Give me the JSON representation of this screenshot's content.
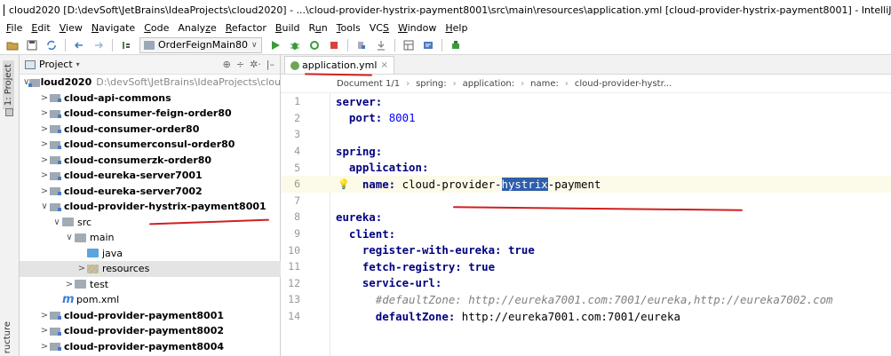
{
  "window": {
    "title": "cloud2020 [D:\\devSoft\\JetBrains\\IdeaProjects\\cloud2020] - ...\\cloud-provider-hystrix-payment8001\\src\\main\\resources\\application.yml [cloud-provider-hystrix-payment8001] - IntelliJ IDEA"
  },
  "menu": [
    {
      "mn": "F",
      "rest": "ile"
    },
    {
      "mn": "E",
      "rest": "dit"
    },
    {
      "mn": "V",
      "rest": "iew"
    },
    {
      "mn": "N",
      "rest": "avigate"
    },
    {
      "mn": "C",
      "rest": "ode"
    },
    {
      "mn": "",
      "rest": "Analy",
      "mn2": "z",
      "rest2": "e"
    },
    {
      "mn": "R",
      "rest": "efactor"
    },
    {
      "mn": "B",
      "rest": "uild"
    },
    {
      "mn": "",
      "rest": "R",
      "mn2": "u",
      "rest2": "n"
    },
    {
      "mn": "T",
      "rest": "ools"
    },
    {
      "mn": "",
      "rest": "VC",
      "mn2": "S",
      "rest2": ""
    },
    {
      "mn": "W",
      "rest": "indow"
    },
    {
      "mn": "H",
      "rest": "elp"
    }
  ],
  "toolbar": {
    "run_config": "OrderFeignMain80"
  },
  "side": {
    "project_tab": "1: Project",
    "structure_tab": "ructure"
  },
  "project_panel": {
    "title": "Project",
    "tree": [
      {
        "label": "cloud2020",
        "path": "D:\\devSoft\\JetBrains\\IdeaProjects\\clou",
        "arrow": "∨",
        "icon": "module",
        "bold": true
      },
      {
        "label": "cloud-api-commons",
        "arrow": ">",
        "icon": "module",
        "bold": true
      },
      {
        "label": "cloud-consumer-feign-order80",
        "arrow": ">",
        "icon": "module",
        "bold": true
      },
      {
        "label": "cloud-consumer-order80",
        "arrow": ">",
        "icon": "module",
        "bold": true
      },
      {
        "label": "cloud-consumerconsul-order80",
        "arrow": ">",
        "icon": "module",
        "bold": true
      },
      {
        "label": "cloud-consumerzk-order80",
        "arrow": ">",
        "icon": "module",
        "bold": true
      },
      {
        "label": "cloud-eureka-server7001",
        "arrow": ">",
        "icon": "module",
        "bold": true
      },
      {
        "label": "cloud-eureka-server7002",
        "arrow": ">",
        "icon": "module",
        "bold": true
      },
      {
        "label": "cloud-provider-hystrix-payment8001",
        "arrow": "∨",
        "icon": "module",
        "bold": true
      },
      {
        "label": "src",
        "arrow": "∨",
        "icon": "folder",
        "bold": false
      },
      {
        "label": "main",
        "arrow": "∨",
        "icon": "folder",
        "bold": false
      },
      {
        "label": "java",
        "arrow": "",
        "icon": "folder-blue",
        "bold": false
      },
      {
        "label": "resources",
        "arrow": ">",
        "icon": "folder-res",
        "bold": false
      },
      {
        "label": "test",
        "arrow": ">",
        "icon": "folder",
        "bold": false
      },
      {
        "label": "pom.xml",
        "arrow": "",
        "icon": "pom",
        "bold": false
      },
      {
        "label": "cloud-provider-payment8001",
        "arrow": ">",
        "icon": "module",
        "bold": true
      },
      {
        "label": "cloud-provider-payment8002",
        "arrow": ">",
        "icon": "module",
        "bold": true
      },
      {
        "label": "cloud-provider-payment8004",
        "arrow": ">",
        "icon": "module",
        "bold": true
      }
    ]
  },
  "editor": {
    "tab": "application.yml",
    "breadcrumb": [
      "Document 1/1",
      "spring:",
      "application:",
      "name:",
      "cloud-provider-hystr..."
    ],
    "lines": [
      {
        "n": "1",
        "segs": [
          {
            "t": "server:",
            "c": "key"
          }
        ]
      },
      {
        "n": "2",
        "segs": [
          {
            "t": "  port: ",
            "c": "key"
          },
          {
            "t": "8001",
            "c": "num"
          }
        ]
      },
      {
        "n": "3",
        "segs": []
      },
      {
        "n": "4",
        "segs": [
          {
            "t": "spring:",
            "c": "key"
          }
        ]
      },
      {
        "n": "5",
        "segs": [
          {
            "t": "  application:",
            "c": "key"
          }
        ]
      },
      {
        "n": "6",
        "segs": [
          {
            "t": "    name: ",
            "c": "key"
          },
          {
            "t": "cloud-provider-",
            "c": "val"
          },
          {
            "t": "hystrix",
            "c": "hl"
          },
          {
            "t": "-payment",
            "c": "val"
          }
        ]
      },
      {
        "n": "7",
        "segs": []
      },
      {
        "n": "8",
        "segs": [
          {
            "t": "eureka:",
            "c": "key"
          }
        ]
      },
      {
        "n": "9",
        "segs": [
          {
            "t": "  client:",
            "c": "key"
          }
        ]
      },
      {
        "n": "10",
        "segs": [
          {
            "t": "    register-with-eureka: ",
            "c": "key"
          },
          {
            "t": "true",
            "c": "kw"
          }
        ]
      },
      {
        "n": "11",
        "segs": [
          {
            "t": "    fetch-registry: ",
            "c": "key"
          },
          {
            "t": "true",
            "c": "kw"
          }
        ]
      },
      {
        "n": "12",
        "segs": [
          {
            "t": "    service-url:",
            "c": "key"
          }
        ]
      },
      {
        "n": "13",
        "segs": [
          {
            "t": "      #defaultZone: http://eureka7001.com:7001/eureka,http://eureka7002.com",
            "c": "comment"
          }
        ]
      },
      {
        "n": "14",
        "segs": [
          {
            "t": "      defaultZone: ",
            "c": "key"
          },
          {
            "t": "http://eureka7001.com:7001/eureka",
            "c": "val"
          }
        ]
      }
    ]
  },
  "colors": {
    "annotation": "#d02020",
    "selection": "#2f5eab",
    "yaml_key": "#000080",
    "number": "#0000ff"
  }
}
